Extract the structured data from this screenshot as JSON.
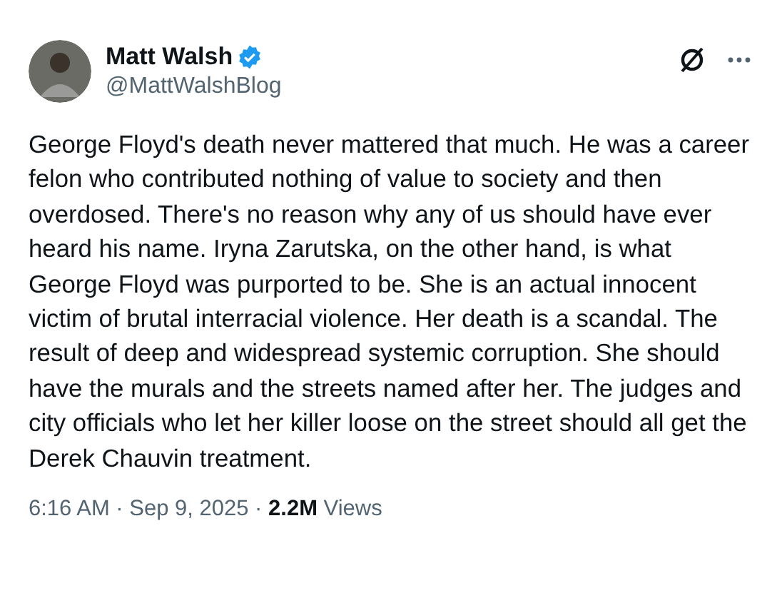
{
  "author": {
    "name": "Matt Walsh",
    "verified": true,
    "handle": "@MattWalshBlog"
  },
  "text": "George Floyd's death never mattered that much. He was a career felon who contributed nothing of value to society and then overdosed. There's no reason why any of us should have ever heard his name. Iryna Zarutska, on the other hand, is what George Floyd was purported to be. She is an actual innocent victim of brutal interracial violence. Her death is a scandal. The result of deep and widespread systemic corruption. She should have the murals and the streets named after her. The judges and city officials who let her killer loose on the street should all get the Derek Chauvin treatment.",
  "meta": "6:16 AM · Sep 9, 2025 · **2.2M** Views"
}
